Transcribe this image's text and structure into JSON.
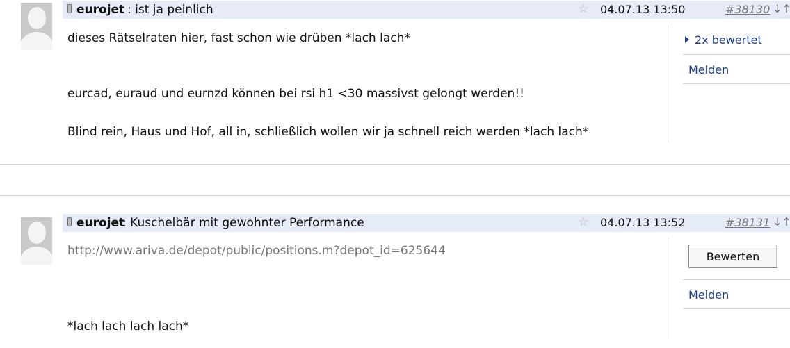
{
  "posts": [
    {
      "author": "eurojet",
      "title_sep": ":",
      "title": "ist ja peinlich",
      "date": "04.07.13 13:50",
      "number": "#38130",
      "arrows": "↓↑",
      "lines": [
        "dieses Rätselraten hier, fast schon wie drüben *lach lach*",
        "eurcad, euraud und eurnzd können bei rsi h1 <30 massivst gelongt werden!!",
        "Blind rein, Haus und Hof, all in, schließlich wollen wir ja schnell reich werden *lach lach*"
      ],
      "rated_label": "2x bewertet",
      "report_label": "Melden"
    },
    {
      "author": "eurojet",
      "title_sep": ":",
      "title": "Kuschelbär mit gewohnter Performance",
      "date": "04.07.13 13:52",
      "number": "#38131",
      "arrows": "↓↑",
      "link": "http://www.ariva.de/depot/public/positions.m?depot_id=625644",
      "lines": [
        "*lach lach lach lach*"
      ],
      "rate_button": "Bewerten",
      "report_label": "Melden"
    }
  ],
  "icons": {
    "star": "☆",
    "phone": "mobile-phone-icon"
  }
}
